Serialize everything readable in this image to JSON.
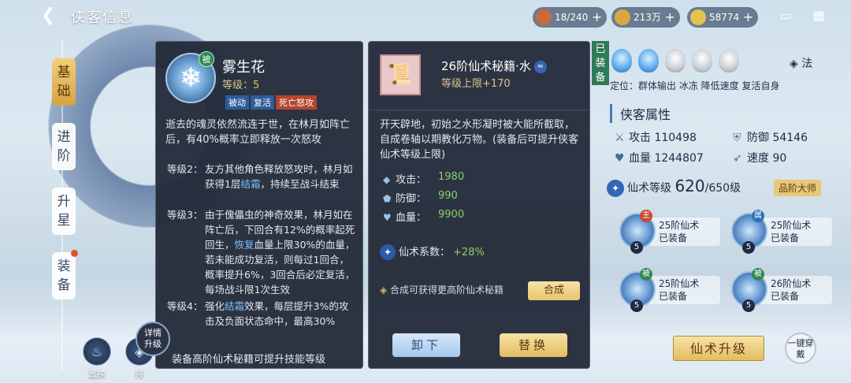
{
  "header": {
    "title": "侠客信息",
    "resources": [
      {
        "name": "bag",
        "value": "18/240",
        "icon": "chest-icon",
        "color": "#c96a3a"
      },
      {
        "name": "coins",
        "value": "213万",
        "icon": "coin-icon",
        "color": "#d9a840"
      },
      {
        "name": "gold",
        "value": "58774",
        "icon": "ingot-icon",
        "color": "#e6c150"
      }
    ]
  },
  "tabs": [
    {
      "label": "基础",
      "active": true
    },
    {
      "label": "进阶",
      "active": false
    },
    {
      "label": "升星",
      "active": false
    },
    {
      "label": "装备",
      "active": false,
      "badge": true
    }
  ],
  "bottom_buttons": {
    "replace": "置换",
    "detail": "详情",
    "upgrade_small": "升级",
    "arrange": "排"
  },
  "skill": {
    "name": "雾生花",
    "badge": "被",
    "level_label": "等级：",
    "level_value": "5",
    "tags": [
      "被动",
      "复活",
      "死亡怒攻"
    ],
    "desc": "逝去的魂灵依然流连于世，在林月如阵亡后，有40%概率立即释放一次怒攻",
    "levels": [
      {
        "k": "等级2：",
        "v1": "友方其他角色释放怒攻时，林月如获得1层",
        "hl": "结霜",
        "v2": "，持续至战斗结束"
      },
      {
        "k": "等级3：",
        "v1": "由于傀儡虫的神奇效果，林月如在阵亡后，下回合有12%的概率起死回生，",
        "hl": "恢复",
        "v2": "血量上限30%的血量，若未能成功复活，则每过1回合，概率提升6%，3回合后必定复活，每场战斗限1次生效"
      },
      {
        "k": "等级4：",
        "v1": "强化",
        "hl": "结霜",
        "v2": "效果，每层提升3%的攻击及负面状态命中，最高30%"
      }
    ],
    "footer": "装备高阶仙术秘籍可提升技能等级"
  },
  "book": {
    "name": "26阶仙术秘籍·水",
    "element_icon": "water-icon",
    "level_cap": "等级上限+170",
    "desc": "开天辟地，初始之水形凝时被大能所截取，自成卷轴以期教化万物。(装备后可提升侠客仙术等级上限)",
    "stats": [
      {
        "label": "攻击：",
        "value": "1980",
        "icon": "attack-icon"
      },
      {
        "label": "防御：",
        "value": "990",
        "icon": "defense-icon"
      },
      {
        "label": "血量：",
        "value": "9900",
        "icon": "hp-icon"
      }
    ],
    "coef_label": "仙术系数：",
    "coef_value": "+28%",
    "synth_text": "合成可获得更高阶仙术秘籍",
    "synth_btn": "合成",
    "unequip": "卸下",
    "replace": "替换",
    "equipped_badge": "已装备"
  },
  "hero": {
    "fa": "法",
    "position": "定位：群体输出 冰冻 降低速度 复活自身",
    "attr_title": "侠客属性",
    "attrs": [
      {
        "label": "攻击",
        "value": "110498",
        "icon": "sword-icon"
      },
      {
        "label": "防御",
        "value": "54146",
        "icon": "shield-icon"
      },
      {
        "label": "血量",
        "value": "1244807",
        "icon": "heart-icon"
      },
      {
        "label": "速度",
        "value": "90",
        "icon": "boot-icon"
      }
    ],
    "xs_label": "仙术等级",
    "xs_level": "620",
    "xs_cap": "/650级",
    "grade": "品阶大师",
    "slots": [
      {
        "title": "25阶仙术",
        "status": "已装备",
        "level": "5",
        "mark": "主",
        "mark_color": "#c94a2a"
      },
      {
        "title": "25阶仙术",
        "status": "已装备",
        "level": "5",
        "mark": "属",
        "mark_color": "#2f6fb8"
      },
      {
        "title": "25阶仙术",
        "status": "已装备",
        "level": "5",
        "mark": "被",
        "mark_color": "#2e8a52"
      },
      {
        "title": "26阶仙术",
        "status": "已装备",
        "level": "5",
        "mark": "被",
        "mark_color": "#2e8a52"
      }
    ],
    "upgrade_btn": "仙术升级",
    "onekey_btn": "一键穿戴"
  }
}
